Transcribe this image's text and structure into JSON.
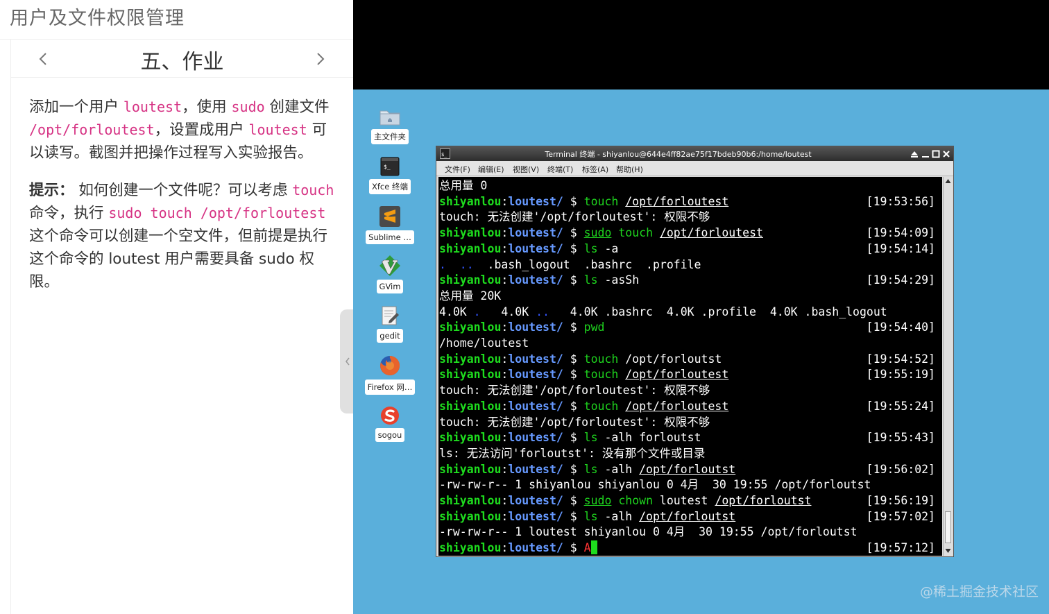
{
  "document": {
    "title": "用户及文件权限管理",
    "section_heading": "五、作业",
    "prev_icon": "chevron-left-icon",
    "next_icon": "chevron-right-icon",
    "p1": {
      "t1": "添加一个用户 ",
      "c1": "loutest",
      "t2": "，使用 ",
      "c2": "sudo",
      "t3": " 创建文件 ",
      "c3": "/opt/forloutest",
      "t4": "，设置成用户 ",
      "c4": "loutest",
      "t5": " 可以读写。截图并把操作过程写入实验报告。"
    },
    "p2": {
      "label": "提示：",
      "t1": " 如何创建一个文件呢？可以考虑 ",
      "c1": "touch",
      "t2": " 命令，执行 ",
      "c2": "sudo touch /opt/forloutest",
      "t3": " 这个命令可以创建一个空文件，但前提是执行这个命令的 loutest 用户需要具备 sudo 权限。"
    },
    "code_color": "#d63384"
  },
  "desktop": {
    "background_color": "#5aafdb",
    "icons": [
      {
        "label": "主文件夹",
        "icon": "folder-icon"
      },
      {
        "label": "Xfce 终端",
        "icon": "terminal-icon"
      },
      {
        "label": "Sublime …",
        "icon": "sublime-icon"
      },
      {
        "label": "GVim",
        "icon": "gvim-icon"
      },
      {
        "label": "gedit",
        "icon": "gedit-icon"
      },
      {
        "label": "Firefox 网…",
        "icon": "firefox-icon"
      },
      {
        "label": "sogou",
        "icon": "sogou-icon"
      }
    ],
    "watermark": "@稀土掘金技术社区"
  },
  "terminal": {
    "title": "Terminal 终端 - shiyanlou@644e4ff82ae75f17bdeb90b6:/home/loutest",
    "menu": [
      "文件(F)",
      "编辑(E)",
      "视图(V)",
      "终端(T)",
      "标签(A)",
      "帮助(H)"
    ],
    "prompt_user": "shiyanlou",
    "prompt_dir": "loutest/",
    "prompt_sym": "$",
    "lines": {
      "l0": "总用量 0",
      "l1": {
        "cmd": "touch",
        "args": "/opt/forloutest",
        "ts": "[19:53:56]"
      },
      "l2": "touch: 无法创建'/opt/forloutest': 权限不够",
      "l3": {
        "pre": "sudo",
        "cmd": "touch",
        "args": "/opt/forloutest",
        "ts": "[19:54:09]"
      },
      "l4": {
        "cmd": "ls",
        "args": "-a",
        "ts": "[19:54:14]"
      },
      "l5": {
        "dots": ".  ..",
        "rest": "  .bash_logout  .bashrc  .profile"
      },
      "l6": {
        "cmd": "ls",
        "args": "-asSh",
        "ts": "[19:54:29]"
      },
      "l7": "总用量 20K",
      "l8": {
        "a": "4.0K ",
        "b": ".",
        "c": "   4.0K ",
        "d": "..",
        "e": "   4.0K .bashrc  4.0K .profile  4.0K .bash_logout"
      },
      "l9": {
        "cmd": "pwd",
        "ts": "[19:54:40]"
      },
      "l10": "/home/loutest",
      "l11": {
        "cmd": "touch",
        "args": "/opt/forloutst",
        "ts": "[19:54:52]"
      },
      "l12": {
        "cmd": "touch",
        "args": "/opt/forloutest",
        "ts": "[19:55:19]"
      },
      "l13": "touch: 无法创建'/opt/forloutest': 权限不够",
      "l14": {
        "cmd": "touch",
        "args": "/opt/forloutest",
        "ts": "[19:55:24]"
      },
      "l15": "touch: 无法创建'/opt/forloutest': 权限不够",
      "l16": {
        "cmd": "ls",
        "args": "-alh forloutst",
        "ts": "[19:55:43]"
      },
      "l17": "ls: 无法访问'forloutst': 没有那个文件或目录",
      "l18": {
        "cmd": "ls",
        "args1": "-alh ",
        "args2": "/opt/forloutst",
        "ts": "[19:56:02]"
      },
      "l19": "-rw-rw-r-- 1 shiyanlou shiyanlou 0 4月  30 19:55 /opt/forloutst",
      "l20": {
        "pre": "sudo",
        "cmd": "chown",
        "args1": " loutest ",
        "args2": "/opt/forloutst",
        "ts": "[19:56:19]"
      },
      "l21": {
        "cmd": "ls",
        "args1": "-alh ",
        "args2": "/opt/forloutst",
        "ts": "[19:57:02]"
      },
      "l22": "-rw-rw-r-- 1 loutest shiyanlou 0 4月  30 19:55 /opt/forloutst",
      "l23": {
        "typed": "A",
        "ts": "[19:57:12]"
      }
    }
  }
}
